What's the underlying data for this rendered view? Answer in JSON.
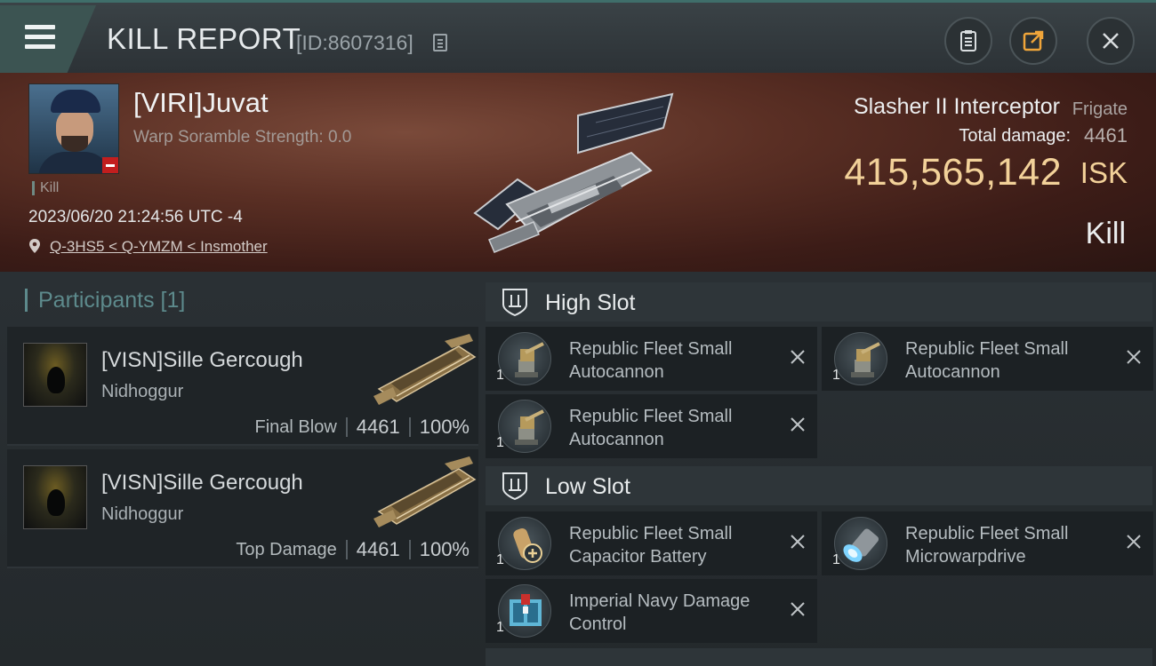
{
  "header": {
    "title": "KILL REPORT",
    "report_id": "[ID:8607316]",
    "menu_icon": "hamburger-menu-icon",
    "buttons": [
      {
        "name": "clipboard-button",
        "icon": "clipboard-icon"
      },
      {
        "name": "share-button",
        "icon": "export-icon"
      },
      {
        "name": "close-button",
        "icon": "close-icon"
      }
    ]
  },
  "victim": {
    "name": "[VIRI]Juvat",
    "scramble": "Warp Soramble Strength: 0.0",
    "kill_tag": "Kill",
    "datetime": "2023/06/20 21:24:56 UTC -4",
    "location": "Q-3HS5 < Q-YMZM < Insmother",
    "ship_name": "Slasher II Interceptor",
    "ship_class": "Frigate",
    "total_damage_label": "Total damage:",
    "total_damage": "4461",
    "isk_value": "415,565,142",
    "isk_unit": "ISK",
    "result": "Kill"
  },
  "participants": {
    "title": "Participants [1]",
    "items": [
      {
        "name": "[VISN]Sille Gercough",
        "ship": "Nidhoggur",
        "label": "Final Blow",
        "damage": "4461",
        "percent": "100%"
      },
      {
        "name": "[VISN]Sille Gercough",
        "ship": "Nidhoggur",
        "label": "Top Damage",
        "damage": "4461",
        "percent": "100%"
      }
    ]
  },
  "slots": {
    "high": {
      "title": "High Slot",
      "modules": [
        {
          "name": "Republic Fleet Small Autocannon",
          "qty": "1",
          "icon": "autocannon-icon"
        },
        {
          "name": "Republic Fleet Small Autocannon",
          "qty": "1",
          "icon": "autocannon-icon"
        },
        {
          "name": "Republic Fleet Small Autocannon",
          "qty": "1",
          "icon": "autocannon-icon"
        }
      ]
    },
    "low": {
      "title": "Low Slot",
      "modules": [
        {
          "name": "Republic Fleet Small Capacitor Battery",
          "qty": "1",
          "icon": "capacitor-battery-icon"
        },
        {
          "name": "Republic Fleet Small Microwarpdrive",
          "qty": "1",
          "icon": "microwarpdrive-icon"
        },
        {
          "name": "Imperial Navy Damage Control",
          "qty": "1",
          "icon": "damage-control-icon"
        }
      ]
    }
  },
  "colors": {
    "isk": "#f2d199",
    "accent": "#5d8a8c"
  }
}
